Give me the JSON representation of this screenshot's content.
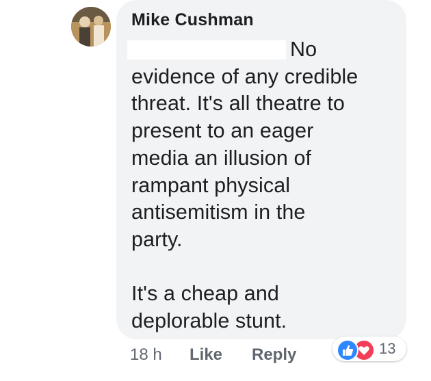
{
  "comment": {
    "author": "Mike Cushman",
    "first_word": "No",
    "body": "evidence of any credible\nthreat. It's all theatre to\npresent to an eager\nmedia an illusion of\nrampant physical\nantisemitism in the\nparty.\n\nIt's a cheap and\ndeplorable stunt."
  },
  "actions": {
    "time": "18 h",
    "like_label": "Like",
    "reply_label": "Reply"
  },
  "reactions": {
    "count": "13",
    "icons": [
      "like-icon",
      "love-icon"
    ],
    "colors": {
      "like": "#2d88ff",
      "love": "#f33e58"
    }
  }
}
